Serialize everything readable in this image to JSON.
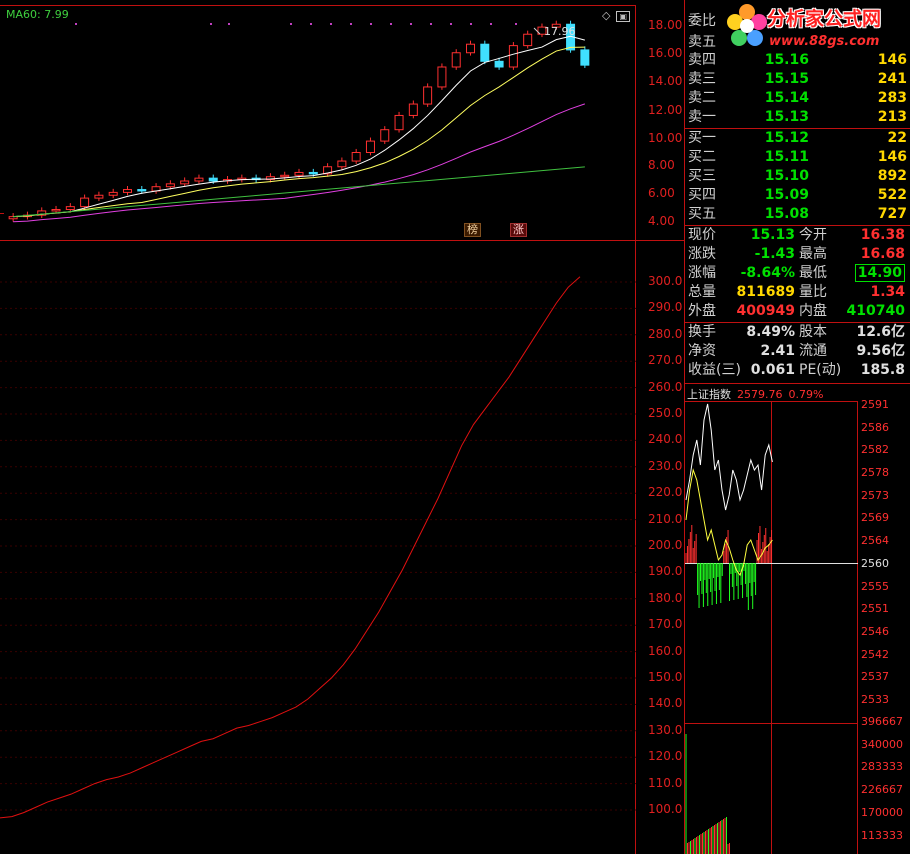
{
  "ma_label": "MA60: 7.99",
  "peak_label": "17.96",
  "tags": {
    "bang": "榜",
    "zhang": "涨"
  },
  "upper_yticks": [
    "18.00",
    "16.00",
    "14.00",
    "12.00",
    "10.00",
    "8.00",
    "6.00",
    "4.00"
  ],
  "lower_yticks": [
    "300.0",
    "290.0",
    "280.0",
    "270.0",
    "260.0",
    "250.0",
    "240.0",
    "230.0",
    "220.0",
    "210.0",
    "200.0",
    "190.0",
    "180.0",
    "170.0",
    "160.0",
    "150.0",
    "140.0",
    "130.0",
    "120.0",
    "110.0",
    "100.0"
  ],
  "logo": {
    "brand": "分析家公式网",
    "url": "www.88gs.com"
  },
  "order_book": {
    "sell": [
      {
        "label": "卖五",
        "price": "",
        "vol": ""
      },
      {
        "label": "卖四",
        "price": "15.16",
        "vol": "146"
      },
      {
        "label": "卖三",
        "price": "15.15",
        "vol": "241"
      },
      {
        "label": "卖二",
        "price": "15.14",
        "vol": "283"
      },
      {
        "label": "卖一",
        "price": "15.13",
        "vol": "213"
      }
    ],
    "buy": [
      {
        "label": "买一",
        "price": "15.12",
        "vol": "22"
      },
      {
        "label": "买二",
        "price": "15.11",
        "vol": "146"
      },
      {
        "label": "买三",
        "price": "15.10",
        "vol": "892"
      },
      {
        "label": "买四",
        "price": "15.09",
        "vol": "522"
      },
      {
        "label": "买五",
        "price": "15.08",
        "vol": "727"
      }
    ],
    "top_label": "委比"
  },
  "stats": [
    {
      "l1": "现价",
      "v1": "15.13",
      "c1": "g",
      "l2": "今开",
      "v2": "16.38",
      "c2": "r"
    },
    {
      "l1": "涨跌",
      "v1": "-1.43",
      "c1": "g",
      "l2": "最高",
      "v2": "16.68",
      "c2": "r"
    },
    {
      "l1": "涨幅",
      "v1": "-8.64%",
      "c1": "g",
      "l2": "最低",
      "v2": "14.90",
      "c2": "g"
    },
    {
      "l1": "总量",
      "v1": "811689",
      "c1": "y",
      "l2": "量比",
      "v2": "1.34",
      "c2": "r"
    },
    {
      "l1": "外盘",
      "v1": "400949",
      "c1": "r",
      "l2": "内盘",
      "v2": "410740",
      "c2": "g"
    },
    {
      "l1": "换手",
      "v1": "8.49%",
      "c1": "w",
      "l2": "股本",
      "v2": "12.6亿",
      "c2": "w"
    },
    {
      "l1": "净资",
      "v1": "2.41",
      "c1": "w",
      "l2": "流通",
      "v2": "9.56亿",
      "c2": "w"
    },
    {
      "l1": "收益(三)",
      "v1": "0.061",
      "c1": "w",
      "l2": "PE(动)",
      "v2": "185.8",
      "c2": "w"
    }
  ],
  "index": {
    "name": "上证指数",
    "value": "2579.76",
    "pct": "0.79%",
    "ticks": [
      "2591",
      "2586",
      "2582",
      "2578",
      "2573",
      "2569",
      "2564",
      "2560",
      "2555",
      "2551",
      "2546",
      "2542",
      "2537",
      "2533"
    ],
    "vol_ticks": [
      "396667",
      "340000",
      "283333",
      "226667",
      "170000",
      "113333"
    ]
  },
  "chart_data": [
    {
      "type": "candlestick",
      "ylim": [
        3.0,
        19.0
      ],
      "yticks": [
        4,
        6,
        8,
        10,
        12,
        14,
        16,
        18
      ],
      "ma_label": "MA60: 7.99",
      "peak_annotation": 17.96,
      "closes": [
        4.5,
        4.6,
        4.9,
        5.0,
        5.2,
        5.8,
        6.0,
        6.2,
        6.4,
        6.3,
        6.6,
        6.8,
        7.0,
        7.2,
        7.0,
        7.1,
        7.2,
        7.1,
        7.3,
        7.4,
        7.6,
        7.5,
        8.0,
        8.4,
        9.0,
        9.8,
        10.6,
        11.6,
        12.4,
        13.6,
        15.0,
        16.0,
        16.6,
        15.4,
        15.0,
        16.5,
        17.3,
        17.8,
        18.0,
        16.2,
        15.13
      ],
      "series": [
        {
          "name": "MA5",
          "color": "#ffffff"
        },
        {
          "name": "MA10",
          "color": "#ffff60"
        },
        {
          "name": "MA20",
          "color": "#e040e0"
        },
        {
          "name": "MA60",
          "color": "#40c040"
        }
      ]
    },
    {
      "type": "line",
      "ylim": [
        95,
        305
      ],
      "color": "#e01010",
      "values": [
        97,
        97.5,
        99,
        101,
        103,
        104.5,
        106,
        108,
        110,
        111.5,
        112.5,
        114,
        116,
        118,
        120,
        122,
        124,
        126,
        127,
        129,
        131,
        132,
        133.5,
        135,
        137,
        139,
        142,
        146,
        150,
        155,
        161,
        168,
        175,
        183,
        191,
        200,
        209,
        218,
        228,
        238,
        246,
        252,
        258,
        264,
        271,
        278,
        285,
        292,
        298,
        302
      ]
    }
  ]
}
